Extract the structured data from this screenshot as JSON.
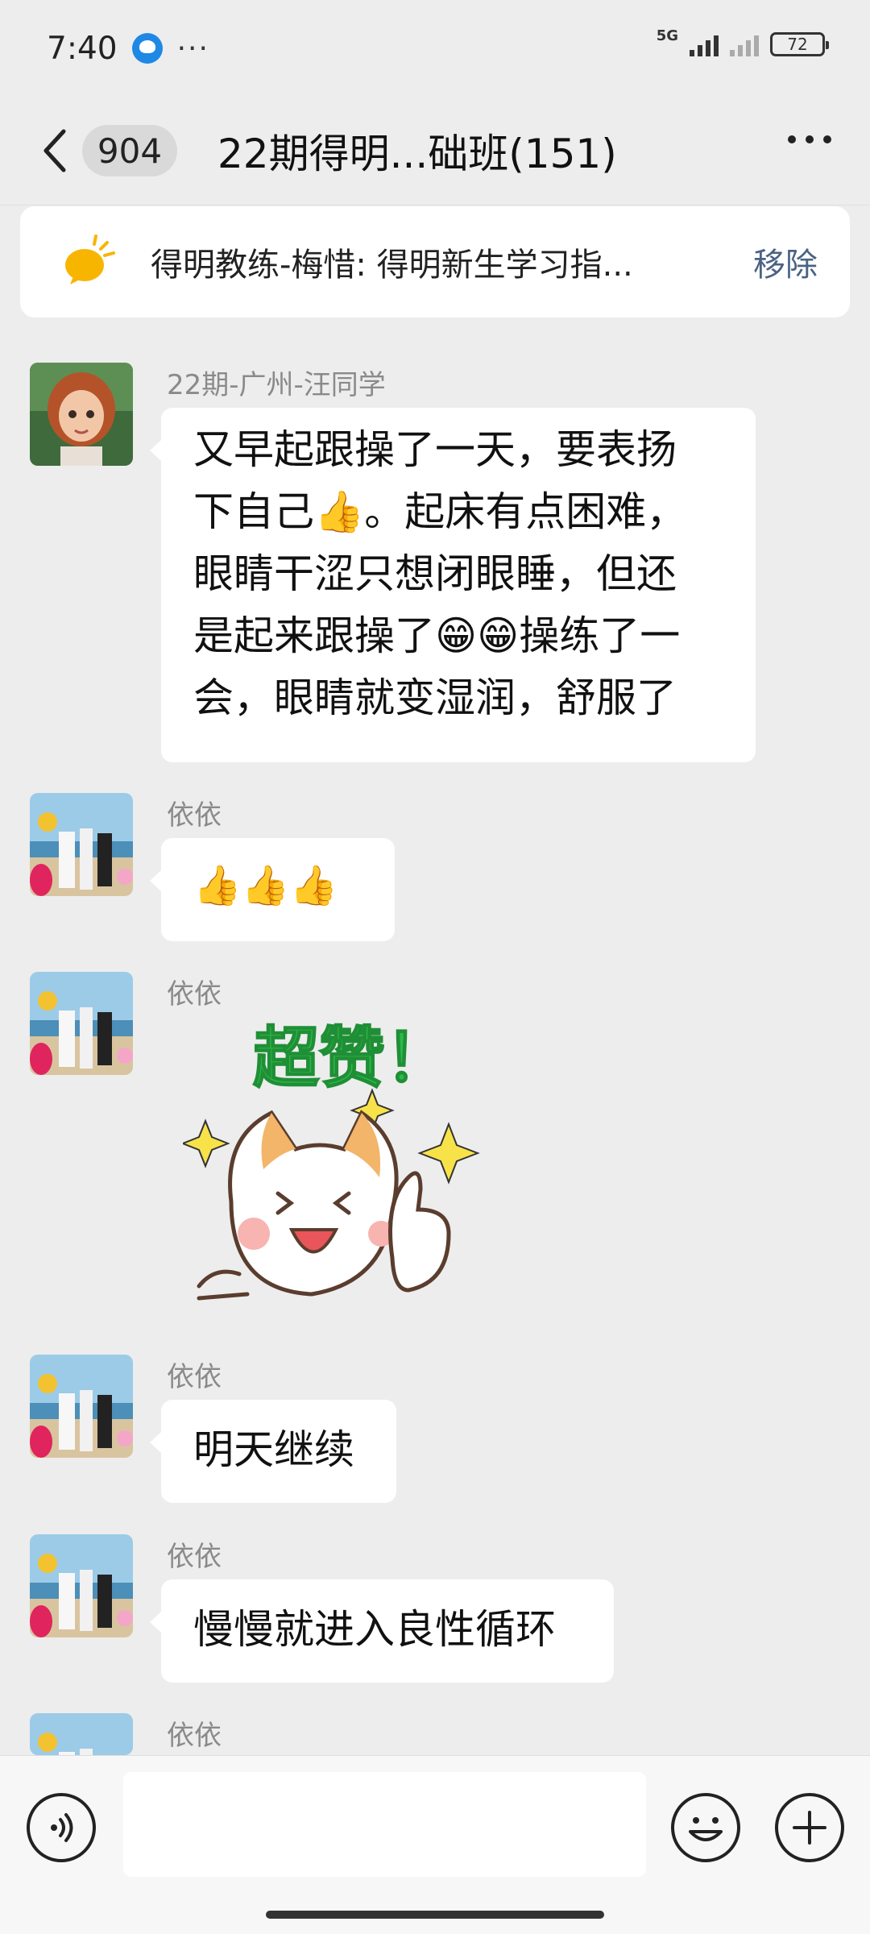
{
  "status_bar": {
    "time": "7:40",
    "more": "···",
    "network": "5G",
    "battery": "72"
  },
  "nav": {
    "unread_count": "904",
    "title": "22期得明...础班(151)"
  },
  "pinned": {
    "text": "得明教练-梅惜: 得明新生学习指...",
    "remove_label": "移除"
  },
  "messages": [
    {
      "sender": "22期-广州-汪同学",
      "lines": [
        "又早起跟操了一天，要表扬",
        "下自己👍。起床有点困难，",
        "眼睛干涩只想闭眼睡，但还",
        "是起来跟操了😁😁操练了一",
        "会，眼睛就变湿润，舒服了"
      ]
    },
    {
      "sender": "依依",
      "text": "👍👍👍"
    },
    {
      "sender": "依依",
      "sticker_text": "超赞！"
    },
    {
      "sender": "依依",
      "text": "明天继续"
    },
    {
      "sender": "依依",
      "text": "慢慢就进入良性循环"
    },
    {
      "sender": "依依"
    }
  ],
  "input": {
    "placeholder": ""
  },
  "colors": {
    "background": "#ededed",
    "bubble": "#ffffff",
    "link": "#4b6284",
    "sticker_green": "#2eb84a"
  }
}
